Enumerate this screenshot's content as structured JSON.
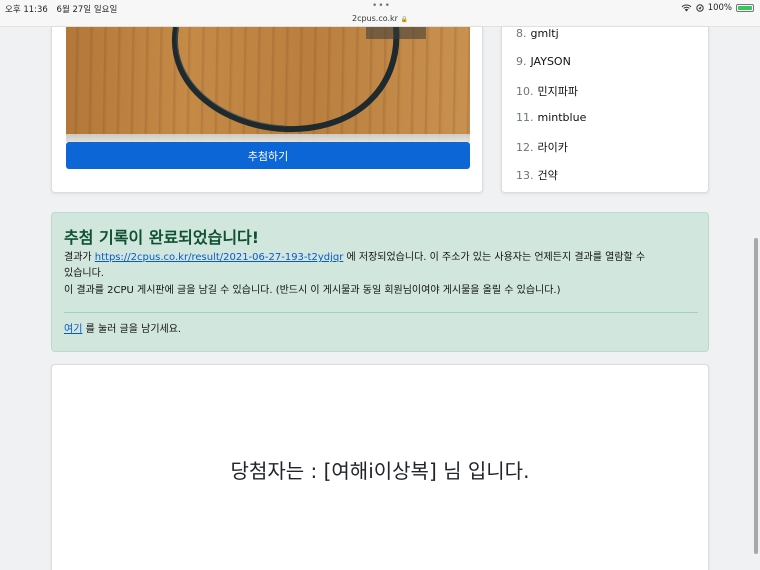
{
  "status_bar": {
    "time": "오후 11:36",
    "date": "6월 27일 일요일",
    "url": "2cpus.co.kr",
    "battery": "100%",
    "dots": "•••"
  },
  "draw_button": {
    "label": "추첨하기"
  },
  "ranking": {
    "items": [
      {
        "num": "8.",
        "name": "gmltj"
      },
      {
        "num": "9.",
        "name": "JAYSON"
      },
      {
        "num": "10.",
        "name": "민지파파"
      },
      {
        "num": "11.",
        "name": "mintblue"
      },
      {
        "num": "12.",
        "name": "라이카"
      },
      {
        "num": "13.",
        "name": "건약"
      }
    ]
  },
  "alert": {
    "heading": "추첨 기록이 완료되었습니다!",
    "prefix": "결과가 ",
    "link": "https://2cpus.co.kr/result/2021-06-27-193-t2ydjqr",
    "suffix_line1": " 에 저장되었습니다. 이 주소가 있는 사용자는 언제든지 결과를 열람할 수",
    "line2": "있습니다.",
    "line3": "이 결과를 2CPU 게시판에 글을 남길 수 있습니다. (반드시 이 게시물과 동일 회원님이여야 게시물을 올릴 수 있습니다.)",
    "here_link": "여기",
    "here_suffix": " 를 눌러 글을 남기세요."
  },
  "winner": {
    "text": "당첨자는 : [여해i이상복] 님 입니다."
  },
  "colors": {
    "primary": "#0d66d6",
    "alert_bg": "#d1e7dd",
    "alert_text": "#0f5132"
  }
}
